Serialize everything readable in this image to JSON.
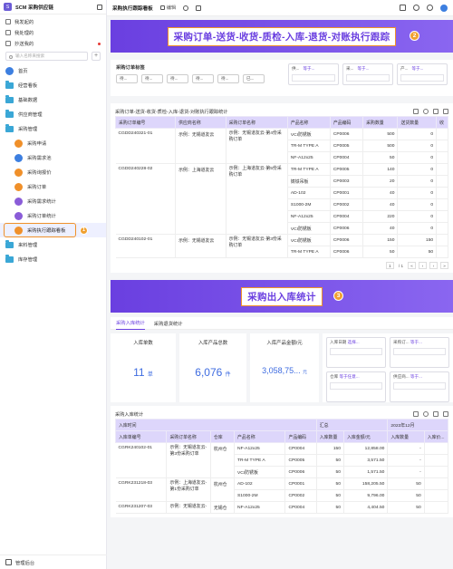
{
  "app": {
    "title": "SCM 采购供应链"
  },
  "sidebar": {
    "top_items": [
      {
        "label": "我发起的"
      },
      {
        "label": "我处理的"
      },
      {
        "label": "抄送我的"
      }
    ],
    "search_placeholder": "输入名称来搜索",
    "nav": [
      {
        "label": "首页"
      },
      {
        "label": "经营看板"
      },
      {
        "label": "基础数据"
      },
      {
        "label": "供应商管理"
      },
      {
        "label": "采购管理"
      },
      {
        "label": "采购申请"
      },
      {
        "label": "采购需求池"
      },
      {
        "label": "采购询报价"
      },
      {
        "label": "采购订单"
      },
      {
        "label": "采购需求统计"
      },
      {
        "label": "采购订单统计"
      },
      {
        "label": "采购执行跟踪看板"
      },
      {
        "label": "来料管理"
      },
      {
        "label": "库存管理"
      }
    ],
    "active_badge": "1",
    "footer": "管理后台"
  },
  "topbar": {
    "title": "采购执行跟踪看板",
    "edit_label": "编辑"
  },
  "banner1": {
    "title": "采购订单-送货-收货-质检-入库-退货-对账执行跟踪",
    "badge": "2"
  },
  "filter1": {
    "label": "采购订单标签",
    "chips": [
      "待...",
      "待...",
      "待...",
      "待...",
      "待...",
      "已..."
    ],
    "selects": [
      {
        "label": "供...",
        "value": "等于..."
      },
      {
        "label": "采...",
        "value": "等于..."
      },
      {
        "label": "产...",
        "value": "等于..."
      }
    ]
  },
  "po_table": {
    "title": "采购订单-送货-收货-质检-入库-退货-对账执行跟踪统计",
    "headers": [
      "采购订单编号",
      "供应商名称",
      "采购订单名称",
      "产品名称",
      "产品编码",
      "采购数量",
      "送货数量",
      "收"
    ],
    "groups": [
      {
        "po": "CGDD240321-01",
        "supplier": "示例：无锡道友云",
        "name": "示例：无锡道友云-第4份采购订单",
        "rows": [
          {
            "product": "VCI防锈板",
            "code": "CP0006",
            "qty": "500",
            "sent": "0"
          },
          {
            "product": "TR-M TYPE A",
            "code": "CP0005",
            "qty": "500",
            "sent": "0"
          },
          {
            "product": "NF-A12x25",
            "code": "CP0004",
            "qty": "50",
            "sent": "0"
          }
        ]
      },
      {
        "po": "CGDD240228-02",
        "supplier": "示例：上海道友云",
        "name": "示例：上海道友云-第5份采购订单",
        "rows": [
          {
            "product": "TR-M TYPE A",
            "code": "CP0005",
            "qty": "140",
            "sent": "0"
          },
          {
            "product": "铸铁吊板",
            "code": "CP0003",
            "qty": "20",
            "sent": "0"
          },
          {
            "product": "AD-102",
            "code": "CP0001",
            "qty": "40",
            "sent": "0"
          },
          {
            "product": "S1000-2M",
            "code": "CP0002",
            "qty": "40",
            "sent": "0"
          },
          {
            "product": "NF-A12x25",
            "code": "CP0004",
            "qty": "220",
            "sent": "0"
          },
          {
            "product": "VCI防锈板",
            "code": "CP0006",
            "qty": "40",
            "sent": "0"
          }
        ]
      },
      {
        "po": "CGDD240102-01",
        "supplier": "示例：无锡道友云",
        "name": "示例：无锡道友云-第3份采购订单",
        "rows": [
          {
            "product": "VCI防锈板",
            "code": "CP0006",
            "qty": "150",
            "sent": "150"
          },
          {
            "product": "TR-M TYPE A",
            "code": "CP0006",
            "qty": "50",
            "sent": "50"
          }
        ]
      }
    ],
    "pager": {
      "page": "1",
      "total": "/ 1"
    }
  },
  "banner2": {
    "title": "采购出入库统计",
    "badge": "3"
  },
  "tabs": [
    {
      "label": "采购入库统计"
    },
    {
      "label": "采购退货统计"
    }
  ],
  "stats": [
    {
      "title": "入库单数",
      "value": "11",
      "unit": "单"
    },
    {
      "title": "入库产品总数",
      "value": "6,076",
      "unit": "件"
    },
    {
      "title": "入库产品金额/元",
      "value": "3,058,75...",
      "unit": "元"
    }
  ],
  "filter2": [
    {
      "label": "入库日期",
      "value": "选择..."
    },
    {
      "label": "采购订...",
      "value": "等于..."
    },
    {
      "label": "仓库",
      "value": "等于任意..."
    },
    {
      "label": "供应商...",
      "value": "等于..."
    }
  ],
  "inbound_table": {
    "title": "采购入库统计",
    "group_headers": {
      "time": "入库时间",
      "summary": "汇总",
      "month": "2023年12月"
    },
    "headers": [
      "入库单编号",
      "采购订单名称",
      "仓库",
      "产品名称",
      "产品编码",
      "入库数量",
      "入库金额/元",
      "入库数量",
      "入库价..."
    ],
    "groups": [
      {
        "no": "CGRK240102-01",
        "name": "示例：无锡道友云-第3份采购订单",
        "wh": "杭州仓",
        "rows": [
          {
            "product": "NF-A12x25",
            "code": "CP0004",
            "qty": "150",
            "amount": "12,858.00",
            "m_qty": "-"
          },
          {
            "product": "TR-M TYPE A",
            "code": "CP0005",
            "qty": "50",
            "amount": "3,571.50",
            "m_qty": "-"
          },
          {
            "product": "VCI防锈板",
            "code": "CP0006",
            "qty": "50",
            "amount": "1,571.50",
            "m_qty": "-"
          }
        ]
      },
      {
        "no": "CGRK231218-03",
        "name": "示例：上海道友云-第1份采购订单",
        "wh": "杭州仓",
        "rows": [
          {
            "product": "AD-102",
            "code": "CP0001",
            "qty": "50",
            "amount": "158,205.50",
            "m_qty": "50"
          },
          {
            "product": "S1000-2M",
            "code": "CP0002",
            "qty": "50",
            "amount": "9,796.00",
            "m_qty": "50"
          }
        ]
      },
      {
        "no": "CGRK231207-03",
        "name": "示例：无锡道友云-",
        "wh": "无锡仓",
        "rows": [
          {
            "product": "NF-A12x25",
            "code": "CP0004",
            "qty": "50",
            "amount": "4,404.50",
            "m_qty": "50"
          }
        ]
      }
    ]
  }
}
